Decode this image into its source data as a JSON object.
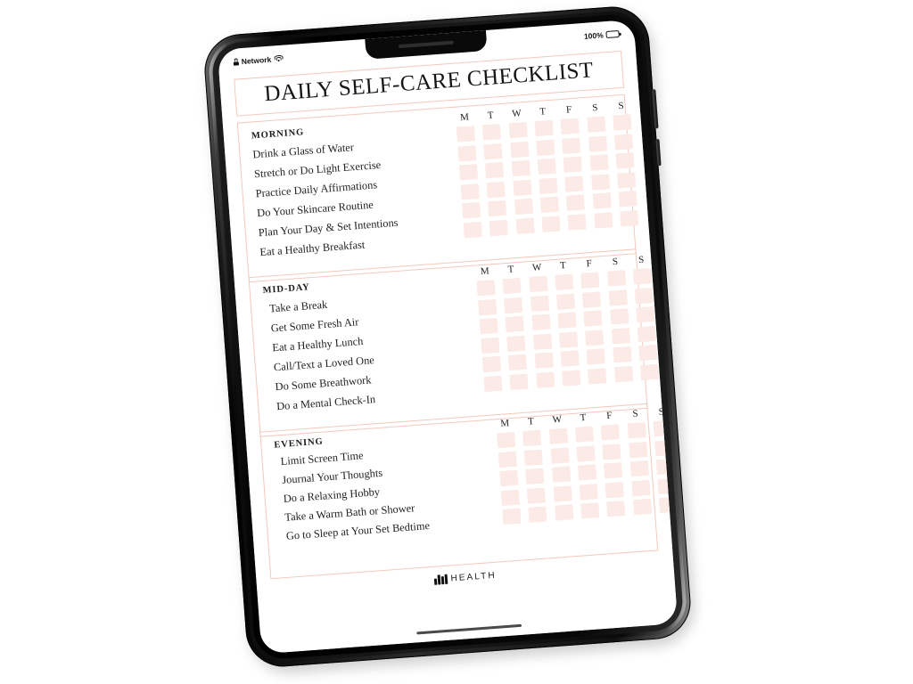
{
  "device": {
    "type": "tablet",
    "status_bar": {
      "lock_icon": "lock-icon",
      "network_label": "Network",
      "wifi_icon": "wifi-icon",
      "battery_percent": "100%",
      "battery_icon": "battery-full-icon"
    }
  },
  "document": {
    "title": "DAILY SELF-CARE CHECKLIST",
    "day_headers": [
      "M",
      "T",
      "W",
      "T",
      "F",
      "S",
      "S"
    ],
    "sections": [
      {
        "heading": "MORNING",
        "tasks": [
          "Drink a Glass of Water",
          "Stretch or Do Light Exercise",
          "Practice Daily Affirmations",
          "Do Your Skincare Routine",
          "Plan Your Day & Set Intentions",
          "Eat a Healthy Breakfast"
        ]
      },
      {
        "heading": "MID-DAY",
        "tasks": [
          "Take a Break",
          "Get Some Fresh Air",
          "Eat a Healthy Lunch",
          "Call/Text a Loved One",
          "Do Some Breathwork",
          "Do a Mental Check-In"
        ]
      },
      {
        "heading": "EVENING",
        "tasks": [
          "Limit Screen Time",
          "Journal Your Thoughts",
          "Do a Relaxing Hobby",
          "Take a Warm Bath or Shower",
          "Go to Sleep at Your Set Bedtime"
        ]
      }
    ],
    "footer": {
      "logo_mark": "vlh-bars-logo-icon",
      "logo_text": "HEALTH"
    }
  },
  "colors": {
    "accent_border": "#f3c9bd",
    "checkbox_fill": "#fbeae5",
    "text": "#1f1f1f",
    "page_background": "#ffffff",
    "bezel": "#0a0a0a"
  }
}
